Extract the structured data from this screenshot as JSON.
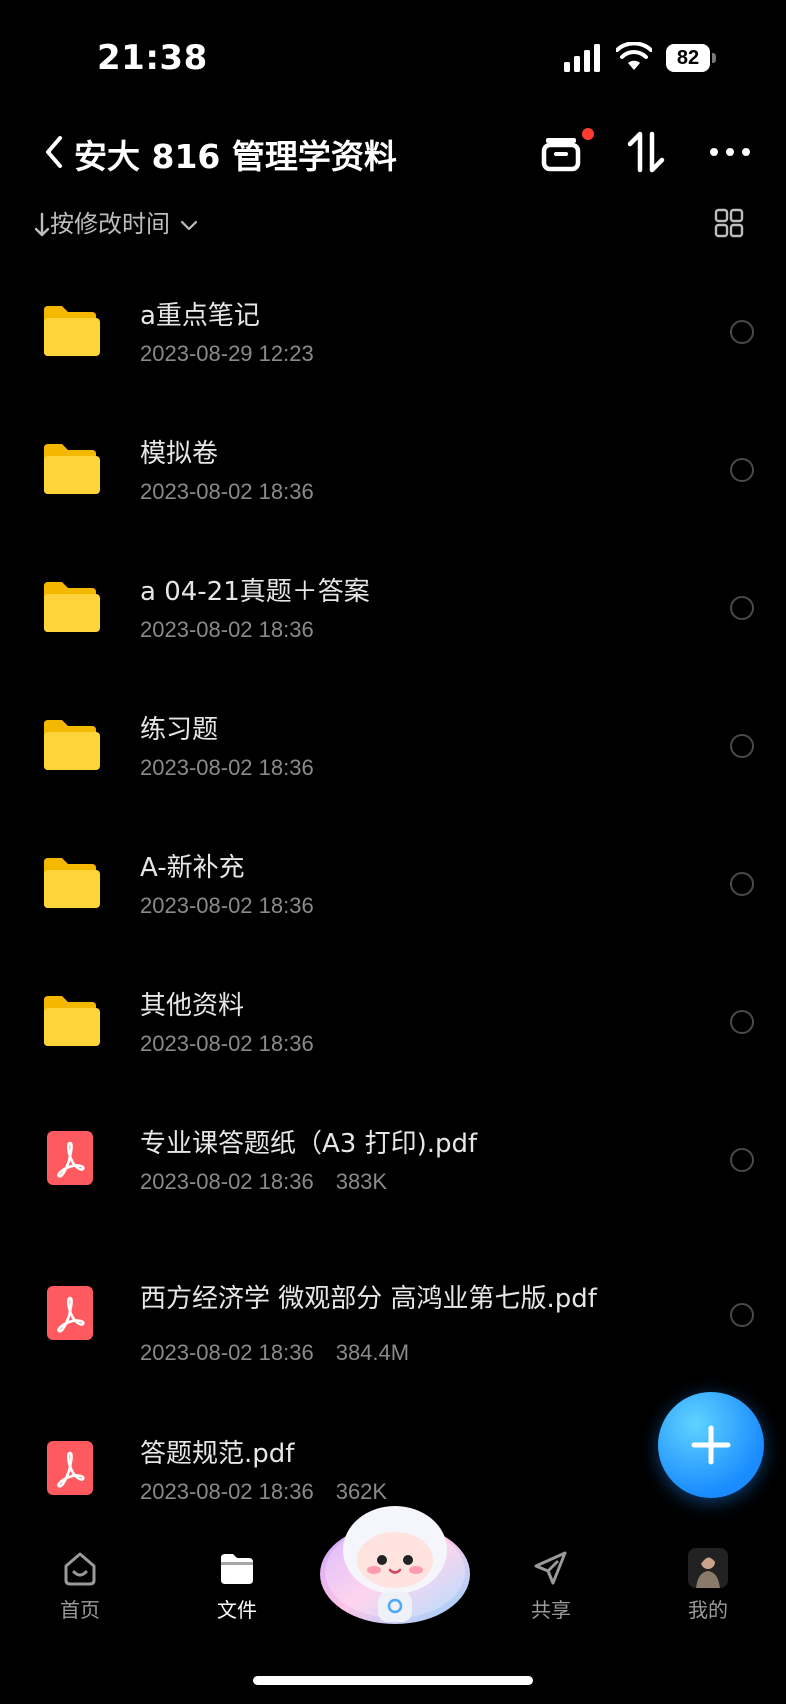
{
  "status_bar": {
    "time": "21:38",
    "battery": "82"
  },
  "header": {
    "title": "安大 816 管理学资料"
  },
  "sort": {
    "label": "按修改时间"
  },
  "files": [
    {
      "name": "a重点笔记",
      "date": "2023-08-29 12:23",
      "size": "",
      "type": "folder"
    },
    {
      "name": "模拟卷",
      "date": "2023-08-02 18:36",
      "size": "",
      "type": "folder"
    },
    {
      "name": "a 04-21真题＋答案",
      "date": "2023-08-02 18:36",
      "size": "",
      "type": "folder"
    },
    {
      "name": "练习题",
      "date": "2023-08-02 18:36",
      "size": "",
      "type": "folder"
    },
    {
      "name": "A-新补充",
      "date": "2023-08-02 18:36",
      "size": "",
      "type": "folder"
    },
    {
      "name": "其他资料",
      "date": "2023-08-02 18:36",
      "size": "",
      "type": "folder"
    },
    {
      "name": "专业课答题纸（A3 打印).pdf",
      "date": "2023-08-02 18:36",
      "size": "383K",
      "type": "pdf"
    },
    {
      "name": "西方经济学 微观部分 高鸿业第七版.pdf",
      "date": "2023-08-02 18:36",
      "size": "384.4M",
      "type": "pdf"
    },
    {
      "name": "答题规范.pdf",
      "date": "2023-08-02 18:36",
      "size": "362K",
      "type": "pdf"
    }
  ],
  "nav": [
    {
      "label": "首页",
      "icon": "home-icon"
    },
    {
      "label": "文件",
      "icon": "folder-icon",
      "active": true
    },
    {
      "label": "",
      "icon": "mascot-icon"
    },
    {
      "label": "共享",
      "icon": "send-icon"
    },
    {
      "label": "我的",
      "icon": "avatar-icon"
    }
  ],
  "colors": {
    "folder": "#ffd43b",
    "pdf": "#ff5a5f",
    "fab": "#1a8cff",
    "badge": "#ff3b30"
  }
}
